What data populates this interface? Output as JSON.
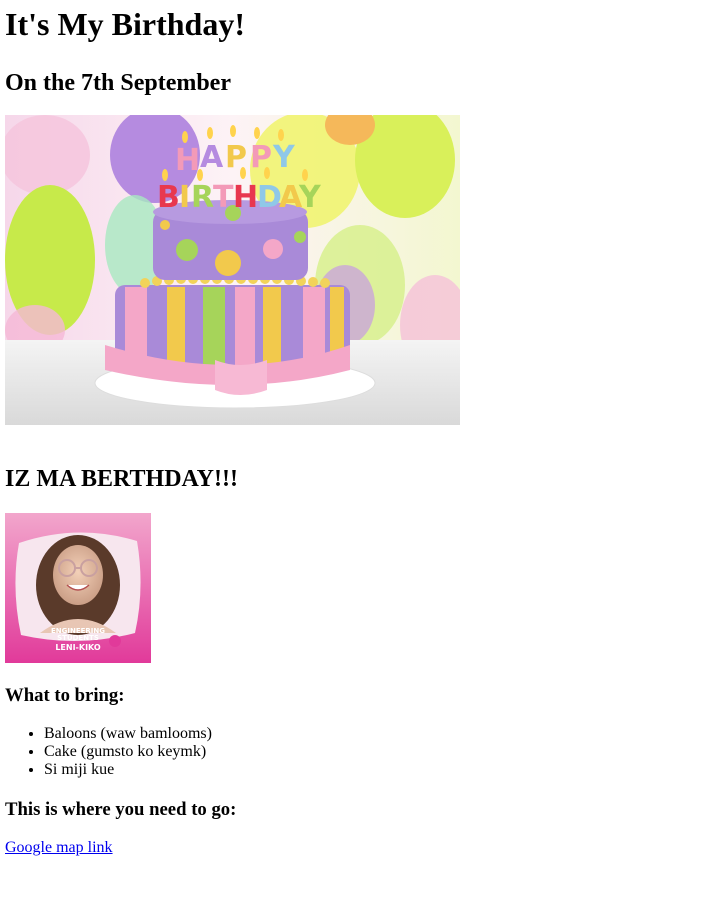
{
  "page": {
    "title": "It's My Birthday!",
    "date_heading": "On the 7th September",
    "cake_image": {
      "alt": "Happy Birthday cake",
      "candle_letters": [
        "H",
        "A",
        "P",
        "P",
        "Y",
        "B",
        "I",
        "R",
        "T",
        "H",
        "D",
        "A",
        "Y"
      ],
      "colors": {
        "purple": "#a98ad8",
        "pink": "#f4a7c8",
        "yellow": "#f2c94c",
        "green": "#a6d45a"
      }
    },
    "section_heading": "IZ MA BERTHDAY!!!",
    "profile_image": {
      "alt": "Profile photo",
      "frame_text_line1": "ENGINEERING",
      "frame_text_line2": "STUDENTS",
      "frame_text_line3": "LENI-KIKO",
      "frame_color": "#e13a9a"
    },
    "bring_heading": "What to bring:",
    "bring_items": [
      "Baloons (waw bamlooms)",
      "Cake (gumsto ko keymk)",
      "Si miji kue"
    ],
    "go_heading": "This is where you need to go:",
    "map_link_text": "Google map link"
  }
}
